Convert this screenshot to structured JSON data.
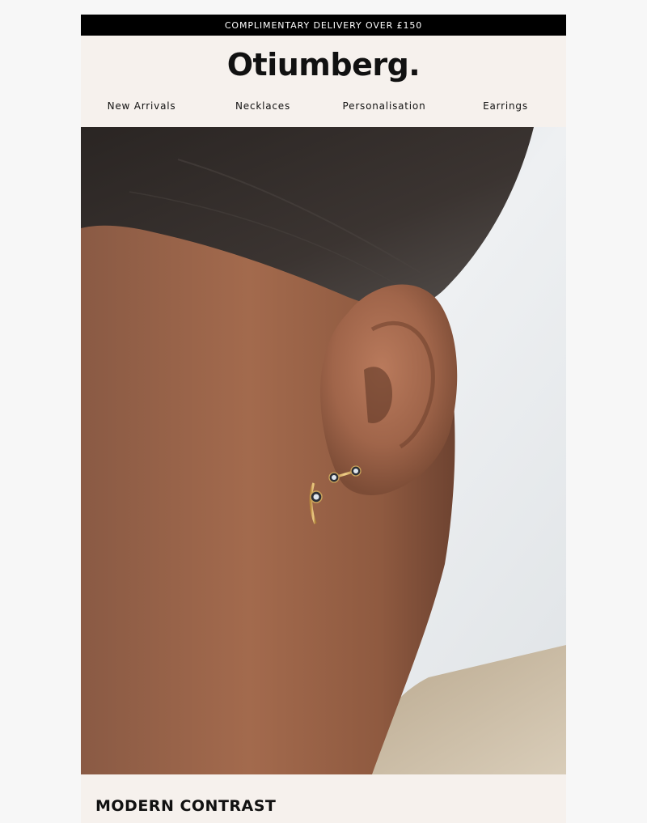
{
  "announcement": "COMPLIMENTARY DELIVERY OVER £150",
  "brand": {
    "logo_text": "Otiumberg."
  },
  "nav": {
    "items": [
      {
        "label": "New Arrivals"
      },
      {
        "label": "Necklaces"
      },
      {
        "label": "Personalisation"
      },
      {
        "label": "Earrings"
      }
    ]
  },
  "hero": {
    "image_alt": ""
  },
  "section": {
    "title": "MODERN CONTRAST"
  },
  "colors": {
    "topbar_bg": "#000000",
    "header_bg": "#f6f1ed",
    "page_bg": "#f7f7f7"
  }
}
